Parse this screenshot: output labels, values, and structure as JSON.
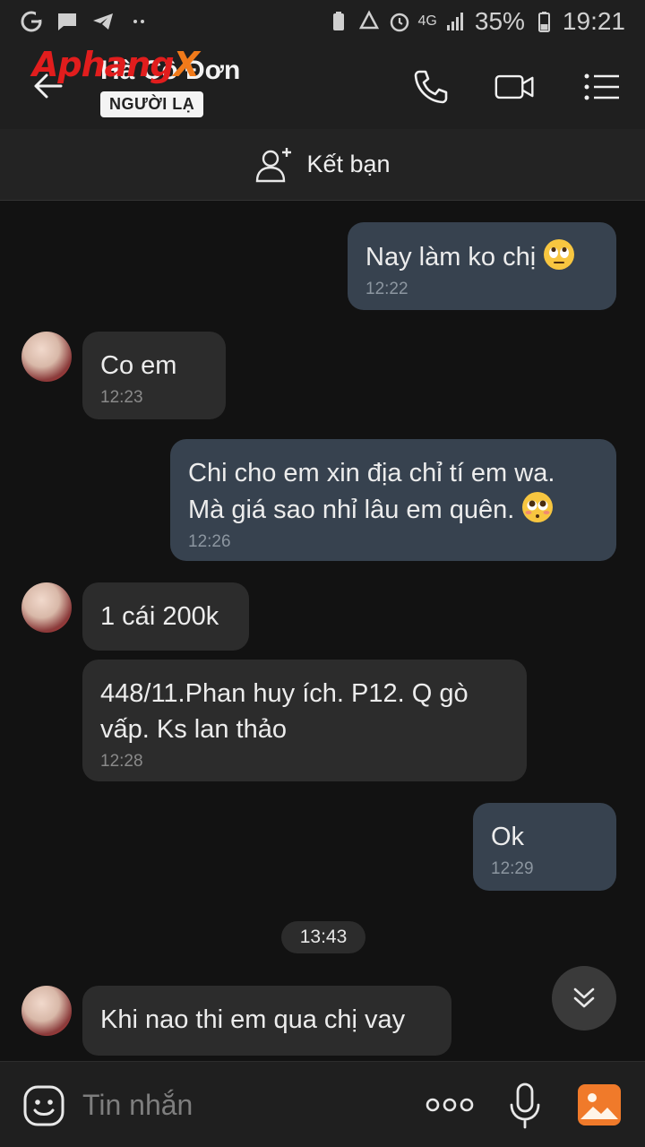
{
  "status_bar": {
    "battery_percent": "35%",
    "time": "19:21",
    "network": "4G",
    "left_icons": [
      "g-icon",
      "message-icon",
      "telegram-icon",
      "dots-icon"
    ]
  },
  "header": {
    "logo_text_a": "Aphang",
    "logo_text_b": "X",
    "contact_name": "Hà Cô Đơn",
    "badge": "NGƯỜI LẠ"
  },
  "add_friend": {
    "label": "Kết bạn"
  },
  "messages": [
    {
      "side": "me",
      "text": "Nay làm ko chị",
      "emoji": "eyes-up",
      "time": "12:22"
    },
    {
      "side": "them",
      "text": "Co em",
      "time": "12:23"
    },
    {
      "side": "me",
      "text_line1": "Chi cho em xin địa chỉ tí em wa.",
      "text_line2": "Mà giá sao nhỉ lâu em quên.",
      "emoji": "pleading",
      "time": "12:26"
    },
    {
      "side": "them",
      "text": "1 cái 200k"
    },
    {
      "side": "them",
      "text_line1": "448/11.Phan huy ích. P12. Q gò",
      "text_line2": "vấp. Ks lan thảo",
      "time": "12:28"
    },
    {
      "side": "me",
      "text": "Ok",
      "time": "12:29"
    },
    {
      "side": "them",
      "text": "Khi nao thi em qua chị vay"
    }
  ],
  "date_separator": "13:43",
  "input": {
    "placeholder": "Tin nhắn"
  },
  "colors": {
    "bg": "#121212",
    "bar": "#1f1f1f",
    "me_bubble": "#37424f",
    "them_bubble": "#2c2c2c",
    "gallery_accent": "#f07a2a"
  }
}
